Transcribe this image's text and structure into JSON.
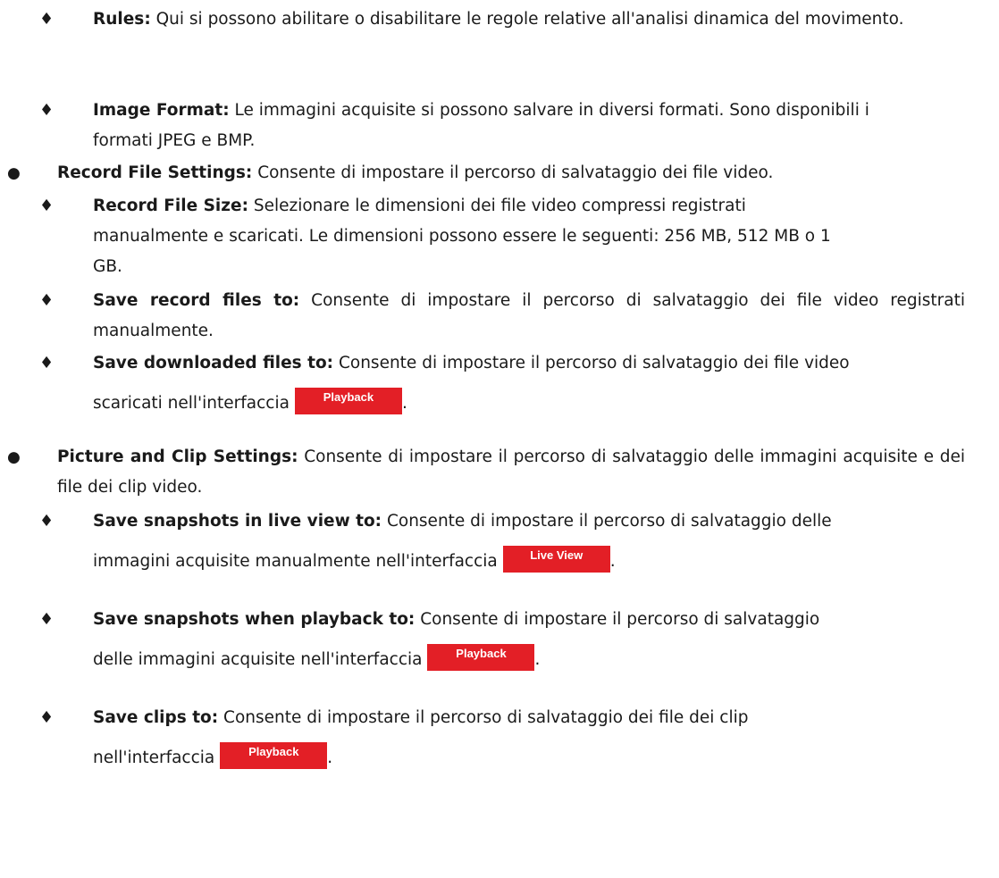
{
  "markers": {
    "diamond": "♦",
    "bullet": "●"
  },
  "items": [
    {
      "label": "Rules:",
      "text": " Qui si possono abilitare o disabilitare le regole relative all'analisi dinamica del movimento."
    },
    {
      "label": "Image Format:",
      "text": " Le immagini acquisite si possono salvare in diversi formati. Sono disponibili i formati JPEG e BMP."
    },
    {
      "label": "Record File Settings:",
      "text": " Consente di impostare il percorso di salvataggio dei file video."
    },
    {
      "label": "Record File Size:",
      "text": " Selezionare le dimensioni dei file video compressi registrati manualmente e scaricati. Le dimensioni possono essere le seguenti: 256 MB, 512 MB o 1 GB."
    },
    {
      "label": "Save record files to:",
      "text": " Consente di impostare il percorso di salvataggio dei file video registrati manualmente."
    },
    {
      "label": "Save downloaded files to:",
      "text_line1": " Consente di impostare il percorso di salvataggio dei file video",
      "text_line2": "scaricati nell'interfaccia",
      "button": "Playback"
    },
    {
      "label": "Picture and Clip Settings:",
      "text": " Consente di impostare il percorso di salvataggio delle immagini acquisite e dei file dei clip video."
    },
    {
      "label": "Save snapshots in live view to:",
      "text_line1": " Consente di impostare il percorso di salvataggio delle",
      "text_line2": "immagini acquisite manualmente nell'interfaccia",
      "button": "Live View"
    },
    {
      "label": "Save snapshots when playback to:",
      "text_line1": " Consente di impostare il percorso di salvataggio",
      "text_line2": "delle immagini acquisite nell'interfaccia",
      "button": "Playback"
    },
    {
      "label": "Save clips to:",
      "text_line1": " Consente di impostare il percorso di salvataggio dei file dei clip",
      "text_line2": "nell'interfaccia",
      "button": "Playback"
    }
  ],
  "punct": "."
}
